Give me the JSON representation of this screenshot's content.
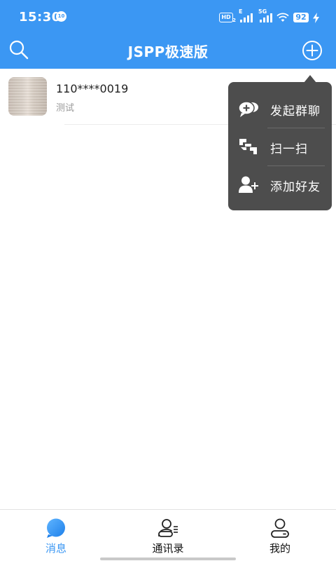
{
  "status_bar": {
    "time": "15:30",
    "notif_badge": "10",
    "hd_label": "HD",
    "hd_sub": "2",
    "sig1_label": "E",
    "sig2_label": "5G",
    "battery": "92"
  },
  "header": {
    "title": "JSPP极速版"
  },
  "chats": [
    {
      "name": "110****0019",
      "preview": "测试"
    }
  ],
  "popup_menu": {
    "items": [
      {
        "label": "发起群聊",
        "icon": "group-chat-icon"
      },
      {
        "label": "扫一扫",
        "icon": "scan-icon"
      },
      {
        "label": "添加好友",
        "icon": "add-friend-icon"
      }
    ]
  },
  "tabs": [
    {
      "label": "消息",
      "icon": "message-icon",
      "active": true
    },
    {
      "label": "通讯录",
      "icon": "contacts-icon",
      "active": false
    },
    {
      "label": "我的",
      "icon": "profile-icon",
      "active": false
    }
  ],
  "colors": {
    "primary": "#3b97f3",
    "popup_bg": "#4d4d4d"
  }
}
